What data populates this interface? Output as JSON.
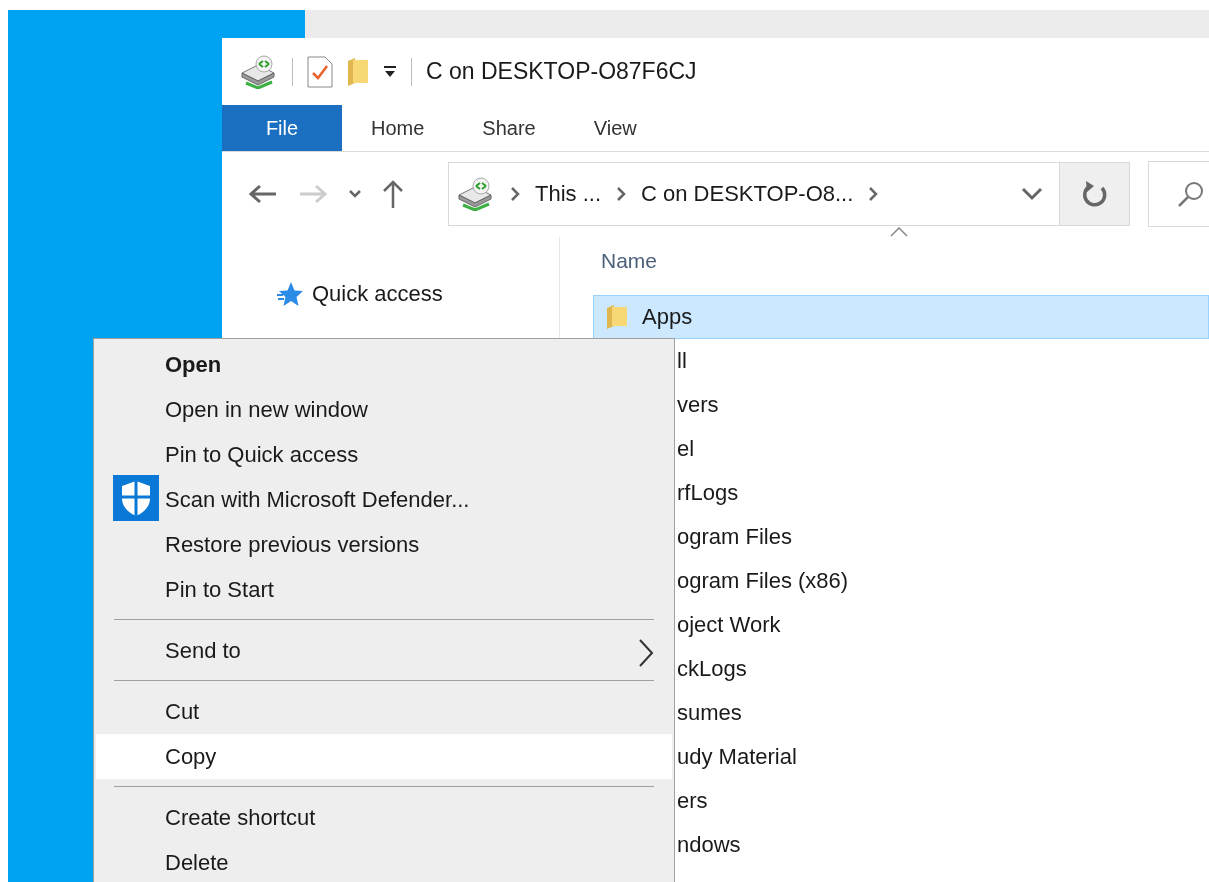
{
  "window": {
    "title": "C on DESKTOP-O87F6CJ"
  },
  "ribbon_tabs": [
    {
      "label": "File",
      "selected": true
    },
    {
      "label": "Home",
      "selected": false
    },
    {
      "label": "Share",
      "selected": false
    },
    {
      "label": "View",
      "selected": false
    }
  ],
  "navigation": {
    "back_disabled": false,
    "forward_disabled": true
  },
  "address_bar": {
    "crumbs": [
      "This ...",
      "C on DESKTOP-O8..."
    ]
  },
  "nav_pane": {
    "items": [
      {
        "label": "Quick access"
      }
    ]
  },
  "file_list": {
    "columns": [
      "Name"
    ],
    "rows": [
      {
        "name": "Apps",
        "selected": true,
        "covered": false
      },
      {
        "name": "ll",
        "selected": false,
        "covered": true
      },
      {
        "name": "vers",
        "selected": false,
        "covered": true
      },
      {
        "name": "el",
        "selected": false,
        "covered": true
      },
      {
        "name": "rfLogs",
        "selected": false,
        "covered": true
      },
      {
        "name": "ogram Files",
        "selected": false,
        "covered": true
      },
      {
        "name": "ogram Files (x86)",
        "selected": false,
        "covered": true
      },
      {
        "name": "oject Work",
        "selected": false,
        "covered": true
      },
      {
        "name": "ckLogs",
        "selected": false,
        "covered": true
      },
      {
        "name": "sumes",
        "selected": false,
        "covered": true
      },
      {
        "name": "udy Material",
        "selected": false,
        "covered": true
      },
      {
        "name": "ers",
        "selected": false,
        "covered": true
      },
      {
        "name": "ndows",
        "selected": false,
        "covered": true
      }
    ]
  },
  "context_menu": {
    "items": [
      {
        "kind": "item",
        "label": "Open",
        "default": true,
        "selected": false
      },
      {
        "kind": "item",
        "label": "Open in new window",
        "default": false,
        "selected": false
      },
      {
        "kind": "item",
        "label": "Pin to Quick access",
        "default": false,
        "selected": false
      },
      {
        "kind": "item",
        "label": "Scan with Microsoft Defender...",
        "default": false,
        "selected": false,
        "has_icon": true
      },
      {
        "kind": "item",
        "label": "Restore previous versions",
        "default": false,
        "selected": false
      },
      {
        "kind": "item",
        "label": "Pin to Start",
        "default": false,
        "selected": false
      },
      {
        "kind": "separator"
      },
      {
        "kind": "item",
        "label": "Send to",
        "default": false,
        "selected": false,
        "submenu": true
      },
      {
        "kind": "separator"
      },
      {
        "kind": "item",
        "label": "Cut",
        "default": false,
        "selected": false
      },
      {
        "kind": "item",
        "label": "Copy",
        "default": false,
        "selected": true
      },
      {
        "kind": "separator"
      },
      {
        "kind": "item",
        "label": "Create shortcut",
        "default": false,
        "selected": false
      },
      {
        "kind": "item",
        "label": "Delete",
        "default": false,
        "selected": false
      }
    ]
  }
}
